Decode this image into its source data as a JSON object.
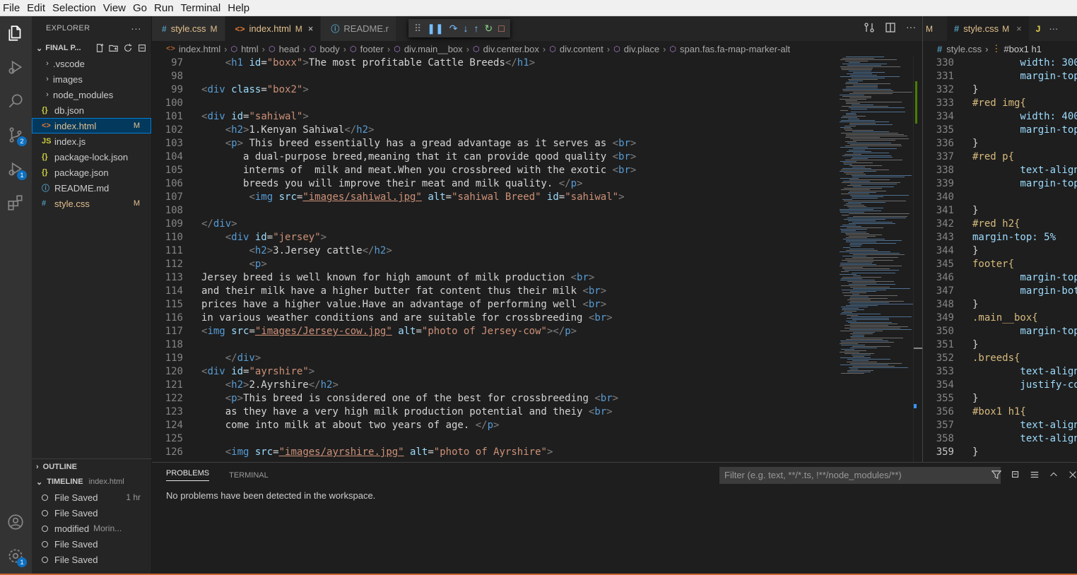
{
  "menubar": [
    "File",
    "Edit",
    "Selection",
    "View",
    "Go",
    "Run",
    "Terminal",
    "Help"
  ],
  "activity": {
    "scm_badge": "2",
    "debug_badge": "1",
    "settings_badge": "1"
  },
  "explorer": {
    "title": "EXPLORER",
    "folder": "FINAL P...",
    "items": [
      {
        "label": ".vscode",
        "type": "folder"
      },
      {
        "label": "images",
        "type": "folder"
      },
      {
        "label": "node_modules",
        "type": "folder"
      },
      {
        "label": "db.json",
        "type": "json",
        "icon": "{}"
      },
      {
        "label": "index.html",
        "type": "html",
        "icon": "<>",
        "flag": "M",
        "selected": true
      },
      {
        "label": "index.js",
        "type": "js",
        "icon": "JS"
      },
      {
        "label": "package-lock.json",
        "type": "json",
        "icon": "{}"
      },
      {
        "label": "package.json",
        "type": "json",
        "icon": "{}"
      },
      {
        "label": "README.md",
        "type": "info",
        "icon": "ⓘ"
      },
      {
        "label": "style.css",
        "type": "css",
        "icon": "#",
        "flag": "M"
      }
    ]
  },
  "outline": {
    "title": "OUTLINE"
  },
  "timeline": {
    "title": "TIMELINE",
    "file": "index.html",
    "items": [
      {
        "label": "File Saved",
        "time": "1 hr"
      },
      {
        "label": "File Saved",
        "time": ""
      },
      {
        "label": "modified",
        "sub": "Morin...",
        "time": ""
      },
      {
        "label": "File Saved",
        "time": ""
      },
      {
        "label": "File Saved",
        "time": ""
      }
    ]
  },
  "tabs": [
    {
      "icon": "#",
      "label": "style.css",
      "flag": "M",
      "active": false
    },
    {
      "icon": "<>",
      "label": "index.html",
      "flag": "M",
      "active": true,
      "close": "×"
    },
    {
      "icon": "ⓘ",
      "label": "README.r",
      "active": false
    }
  ],
  "breadcrumb": [
    "index.html",
    "html",
    "head",
    "body",
    "footer",
    "div.main__box",
    "div.center.box",
    "div.content",
    "div.place",
    "span.fas.fa-map-marker-alt"
  ],
  "code": [
    {
      "n": "97",
      "src": [
        [
          "    ",
          "t"
        ],
        [
          "<",
          "p"
        ],
        [
          "h1",
          "g"
        ],
        [
          " id",
          "a"
        ],
        [
          "=",
          "t"
        ],
        [
          "\"boxx\"",
          "s"
        ],
        [
          ">",
          "p"
        ],
        [
          "The most profitable Cattle Breeds",
          "t"
        ],
        [
          "</",
          "p"
        ],
        [
          "h1",
          "g"
        ],
        [
          ">",
          "p"
        ]
      ]
    },
    {
      "n": "98",
      "src": []
    },
    {
      "n": "99",
      "src": [
        [
          "<",
          "p"
        ],
        [
          "div",
          "g"
        ],
        [
          " class",
          "a"
        ],
        [
          "=",
          "t"
        ],
        [
          "\"box2\"",
          "s"
        ],
        [
          ">",
          "p"
        ]
      ]
    },
    {
      "n": "100",
      "src": []
    },
    {
      "n": "101",
      "src": [
        [
          "<",
          "p"
        ],
        [
          "div",
          "g"
        ],
        [
          " id",
          "a"
        ],
        [
          "=",
          "t"
        ],
        [
          "\"sahiwal\"",
          "s"
        ],
        [
          ">",
          "p"
        ]
      ]
    },
    {
      "n": "102",
      "src": [
        [
          "    ",
          "t"
        ],
        [
          "<",
          "p"
        ],
        [
          "h2",
          "g"
        ],
        [
          ">",
          "p"
        ],
        [
          "1.Kenyan Sahiwal",
          "t"
        ],
        [
          "</",
          "p"
        ],
        [
          "h2",
          "g"
        ],
        [
          ">",
          "p"
        ]
      ]
    },
    {
      "n": "103",
      "src": [
        [
          "    ",
          "t"
        ],
        [
          "<",
          "p"
        ],
        [
          "p",
          "g"
        ],
        [
          ">",
          "p"
        ],
        [
          " This breed essentially has a gread advantage as it serves as ",
          "t"
        ],
        [
          "<",
          "p"
        ],
        [
          "br",
          "g"
        ],
        [
          ">",
          "p"
        ]
      ]
    },
    {
      "n": "104",
      "src": [
        [
          "       a dual-purpose breed,meaning that it can provide qood quality ",
          "t"
        ],
        [
          "<",
          "p"
        ],
        [
          "br",
          "g"
        ],
        [
          ">",
          "p"
        ]
      ]
    },
    {
      "n": "105",
      "src": [
        [
          "       interms of  milk and meat.When you crossbreed with the exotic ",
          "t"
        ],
        [
          "<",
          "p"
        ],
        [
          "br",
          "g"
        ],
        [
          ">",
          "p"
        ]
      ]
    },
    {
      "n": "106",
      "src": [
        [
          "       breeds you will improve their meat and milk quality. ",
          "t"
        ],
        [
          "</",
          "p"
        ],
        [
          "p",
          "g"
        ],
        [
          ">",
          "p"
        ]
      ]
    },
    {
      "n": "107",
      "src": [
        [
          "        ",
          "t"
        ],
        [
          "<",
          "p"
        ],
        [
          "img",
          "g"
        ],
        [
          " src",
          "a"
        ],
        [
          "=",
          "t"
        ],
        [
          "\"images/sahiwal.jpg\"",
          "s"
        ],
        [
          " alt",
          "a"
        ],
        [
          "=",
          "t"
        ],
        [
          "\"sahiwal Breed\"",
          "s"
        ],
        [
          " id",
          "a"
        ],
        [
          "=",
          "t"
        ],
        [
          "\"sahiwal\"",
          "s"
        ],
        [
          ">",
          "p"
        ]
      ]
    },
    {
      "n": "108",
      "src": []
    },
    {
      "n": "109",
      "src": [
        [
          "</",
          "p"
        ],
        [
          "div",
          "g"
        ],
        [
          ">",
          "p"
        ]
      ]
    },
    {
      "n": "110",
      "src": [
        [
          "    ",
          "t"
        ],
        [
          "<",
          "p"
        ],
        [
          "div",
          "g"
        ],
        [
          " id",
          "a"
        ],
        [
          "=",
          "t"
        ],
        [
          "\"jersey\"",
          "s"
        ],
        [
          ">",
          "p"
        ]
      ]
    },
    {
      "n": "111",
      "src": [
        [
          "        ",
          "t"
        ],
        [
          "<",
          "p"
        ],
        [
          "h2",
          "g"
        ],
        [
          ">",
          "p"
        ],
        [
          "3.Jersey cattle",
          "t"
        ],
        [
          "</",
          "p"
        ],
        [
          "h2",
          "g"
        ],
        [
          ">",
          "p"
        ]
      ]
    },
    {
      "n": "112",
      "src": [
        [
          "        ",
          "t"
        ],
        [
          "<",
          "p"
        ],
        [
          "p",
          "g"
        ],
        [
          ">",
          "p"
        ]
      ]
    },
    {
      "n": "113",
      "src": [
        [
          "Jersey breed is well known for high amount of milk production ",
          "t"
        ],
        [
          "<",
          "p"
        ],
        [
          "br",
          "g"
        ],
        [
          ">",
          "p"
        ]
      ]
    },
    {
      "n": "114",
      "src": [
        [
          "and their milk have a higher butter fat content thus their milk ",
          "t"
        ],
        [
          "<",
          "p"
        ],
        [
          "br",
          "g"
        ],
        [
          ">",
          "p"
        ]
      ]
    },
    {
      "n": "115",
      "src": [
        [
          "prices have a higher value.Have an advantage of performing well ",
          "t"
        ],
        [
          "<",
          "p"
        ],
        [
          "br",
          "g"
        ],
        [
          ">",
          "p"
        ]
      ]
    },
    {
      "n": "116",
      "src": [
        [
          "in various weather conditions and are suitable for crossbreeding ",
          "t"
        ],
        [
          "<",
          "p"
        ],
        [
          "br",
          "g"
        ],
        [
          ">",
          "p"
        ]
      ]
    },
    {
      "n": "117",
      "src": [
        [
          "<",
          "p"
        ],
        [
          "img",
          "g"
        ],
        [
          " src",
          "a"
        ],
        [
          "=",
          "t"
        ],
        [
          "\"images/Jersey-cow.jpg\"",
          "s"
        ],
        [
          " alt",
          "a"
        ],
        [
          "=",
          "t"
        ],
        [
          "\"photo of Jersey-cow\"",
          "s"
        ],
        [
          "></",
          "p"
        ],
        [
          "p",
          "g"
        ],
        [
          ">",
          "p"
        ]
      ]
    },
    {
      "n": "118",
      "src": []
    },
    {
      "n": "119",
      "src": [
        [
          "    ",
          "t"
        ],
        [
          "</",
          "p"
        ],
        [
          "div",
          "g"
        ],
        [
          ">",
          "p"
        ]
      ]
    },
    {
      "n": "120",
      "src": [
        [
          "<",
          "p"
        ],
        [
          "div",
          "g"
        ],
        [
          " id",
          "a"
        ],
        [
          "=",
          "t"
        ],
        [
          "\"ayrshire\"",
          "s"
        ],
        [
          ">",
          "p"
        ]
      ]
    },
    {
      "n": "121",
      "src": [
        [
          "    ",
          "t"
        ],
        [
          "<",
          "p"
        ],
        [
          "h2",
          "g"
        ],
        [
          ">",
          "p"
        ],
        [
          "2.Ayrshire",
          "t"
        ],
        [
          "</",
          "p"
        ],
        [
          "h2",
          "g"
        ],
        [
          ">",
          "p"
        ]
      ]
    },
    {
      "n": "122",
      "src": [
        [
          "    ",
          "t"
        ],
        [
          "<",
          "p"
        ],
        [
          "p",
          "g"
        ],
        [
          ">",
          "p"
        ],
        [
          "This breed is considered one of the best for crossbreeding ",
          "t"
        ],
        [
          "<",
          "p"
        ],
        [
          "br",
          "g"
        ],
        [
          ">",
          "p"
        ]
      ]
    },
    {
      "n": "123",
      "src": [
        [
          "    as they have a very high milk production potential and theiy ",
          "t"
        ],
        [
          "<",
          "p"
        ],
        [
          "br",
          "g"
        ],
        [
          ">",
          "p"
        ]
      ]
    },
    {
      "n": "124",
      "src": [
        [
          "    come into milk at about two years of age. ",
          "t"
        ],
        [
          "</",
          "p"
        ],
        [
          "p",
          "g"
        ],
        [
          ">",
          "p"
        ]
      ]
    },
    {
      "n": "125",
      "src": []
    },
    {
      "n": "126",
      "src": [
        [
          "    ",
          "t"
        ],
        [
          "<",
          "p"
        ],
        [
          "img",
          "g"
        ],
        [
          " src",
          "a"
        ],
        [
          "=",
          "t"
        ],
        [
          "\"images/ayrshire.jpg\"",
          "s"
        ],
        [
          " alt",
          "a"
        ],
        [
          "=",
          "t"
        ],
        [
          "\"photo of Ayrshire\"",
          "s"
        ],
        [
          ">",
          "p"
        ]
      ]
    }
  ],
  "split": {
    "tab_prefix": "M",
    "tab_label": "style.css",
    "tab_flag": "M",
    "tab_more": "J",
    "breadcrumb": [
      "style.css",
      "#box1 h1"
    ],
    "code": [
      {
        "n": "330",
        "src": [
          [
            "        width: 300",
            "q"
          ]
        ]
      },
      {
        "n": "331",
        "src": [
          [
            "        margin-top",
            "q"
          ]
        ]
      },
      {
        "n": "332",
        "src": [
          [
            "}",
            "t"
          ]
        ]
      },
      {
        "n": "333",
        "src": [
          [
            "#red img{",
            "e"
          ]
        ]
      },
      {
        "n": "334",
        "src": [
          [
            "        width: 400",
            "q"
          ]
        ]
      },
      {
        "n": "335",
        "src": [
          [
            "        margin-top",
            "q"
          ]
        ]
      },
      {
        "n": "336",
        "src": [
          [
            "}",
            "t"
          ]
        ]
      },
      {
        "n": "337",
        "src": [
          [
            "#red p{",
            "e"
          ]
        ]
      },
      {
        "n": "338",
        "src": [
          [
            "        text-align",
            "q"
          ]
        ]
      },
      {
        "n": "339",
        "src": [
          [
            "        margin-top",
            "q"
          ]
        ]
      },
      {
        "n": "340",
        "src": []
      },
      {
        "n": "341",
        "src": [
          [
            "}",
            "t"
          ]
        ]
      },
      {
        "n": "342",
        "src": [
          [
            "#red h2{",
            "e"
          ]
        ]
      },
      {
        "n": "343",
        "src": [
          [
            "margin-top: 5%",
            "q"
          ]
        ]
      },
      {
        "n": "344",
        "src": [
          [
            "}",
            "t"
          ]
        ]
      },
      {
        "n": "345",
        "src": [
          [
            "footer{",
            "e"
          ]
        ]
      },
      {
        "n": "346",
        "src": [
          [
            "        margin-top",
            "q"
          ]
        ]
      },
      {
        "n": "347",
        "src": [
          [
            "        margin-bot",
            "q"
          ]
        ]
      },
      {
        "n": "348",
        "src": [
          [
            "}",
            "t"
          ]
        ]
      },
      {
        "n": "349",
        "src": [
          [
            ".main__box{",
            "e"
          ]
        ]
      },
      {
        "n": "350",
        "src": [
          [
            "        margin-top",
            "q"
          ]
        ]
      },
      {
        "n": "351",
        "src": [
          [
            "}",
            "t"
          ]
        ]
      },
      {
        "n": "352",
        "src": [
          [
            ".breeds{",
            "e"
          ]
        ]
      },
      {
        "n": "353",
        "src": [
          [
            "        text-align",
            "q"
          ]
        ]
      },
      {
        "n": "354",
        "src": [
          [
            "        justify-co",
            "q"
          ]
        ]
      },
      {
        "n": "355",
        "src": [
          [
            "}",
            "t"
          ]
        ]
      },
      {
        "n": "356",
        "src": [
          [
            "#box1 h1{",
            "e"
          ]
        ]
      },
      {
        "n": "357",
        "src": [
          [
            "        text-align",
            "q"
          ]
        ]
      },
      {
        "n": "358",
        "src": [
          [
            "        text-align",
            "q"
          ]
        ]
      },
      {
        "n": "359",
        "src": [
          [
            "}",
            "t"
          ]
        ]
      }
    ]
  },
  "panel": {
    "tabs": [
      "PROBLEMS",
      "TERMINAL"
    ],
    "filter_placeholder": "Filter (e.g. text, **/*.ts, !**/node_modules/**)",
    "message": "No problems have been detected in the workspace."
  }
}
